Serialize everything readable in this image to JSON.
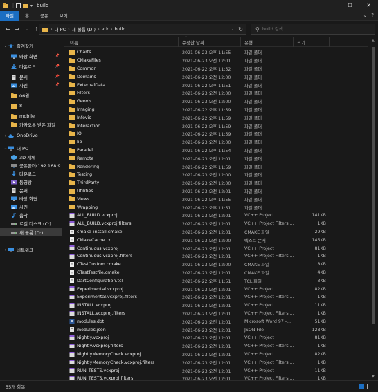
{
  "window": {
    "title": "build",
    "minimize_glyph": "—",
    "maximize_glyph": "☐",
    "close_glyph": "✕"
  },
  "ribbon": {
    "tabs": [
      "파일",
      "홈",
      "공유",
      "보기"
    ],
    "expand_glyph": "⌄",
    "help_glyph": "?"
  },
  "nav": {
    "back": "←",
    "forward": "→",
    "dropdown": "⌄",
    "up": "↑",
    "breadcrumbs": [
      "내 PC",
      "새 볼륨 (D:)",
      "vtk",
      "build"
    ],
    "refresh": "↻",
    "search_placeholder": "build 검색"
  },
  "sidebar": {
    "items": [
      {
        "label": "즐겨찾기",
        "icon": "star-icon",
        "level": 0,
        "chevron": "⌄"
      },
      {
        "label": "바탕 화면",
        "icon": "desktop-icon",
        "level": 1,
        "pinned": true
      },
      {
        "label": "다운로드",
        "icon": "download-icon",
        "level": 1,
        "pinned": true
      },
      {
        "label": "문서",
        "icon": "document-icon",
        "level": 1,
        "pinned": true
      },
      {
        "label": "사진",
        "icon": "pictures-icon",
        "level": 1,
        "pinned": true
      },
      {
        "label": "06월",
        "icon": "folder-icon",
        "level": 1
      },
      {
        "label": "8",
        "icon": "folder-icon",
        "level": 1
      },
      {
        "label": "mobile",
        "icon": "folder-icon",
        "level": 1
      },
      {
        "label": "카카오톡 받은 파일",
        "icon": "folder-icon",
        "level": 1
      },
      {
        "label": "OneDrive",
        "icon": "cloud-icon",
        "level": 0,
        "chevron": "›"
      },
      {
        "label": "내 PC",
        "icon": "pc-icon",
        "level": 0,
        "chevron": "⌄"
      },
      {
        "label": "3D 개체",
        "icon": "3d-objects-icon",
        "level": 1
      },
      {
        "label": "공유폴더(192.168.9",
        "icon": "network-drive-icon",
        "level": 1
      },
      {
        "label": "다운로드",
        "icon": "download-icon",
        "level": 1
      },
      {
        "label": "동영상",
        "icon": "video-icon",
        "level": 1
      },
      {
        "label": "문서",
        "icon": "document-icon",
        "level": 1
      },
      {
        "label": "바탕 화면",
        "icon": "desktop-icon",
        "level": 1
      },
      {
        "label": "사진",
        "icon": "pictures-icon",
        "level": 1
      },
      {
        "label": "음악",
        "icon": "music-icon",
        "level": 1
      },
      {
        "label": "로컬 디스크 (C:)",
        "icon": "drive-icon",
        "level": 1
      },
      {
        "label": "새 볼륨 (D:)",
        "icon": "drive-icon",
        "level": 1,
        "selected": true
      },
      {
        "label": "네트워크",
        "icon": "network-icon",
        "level": 0,
        "chevron": "›"
      }
    ]
  },
  "columns": {
    "name": "이름",
    "date": "수정한 날짜",
    "type": "유형",
    "size": "크기",
    "sort_glyph": "^"
  },
  "files": [
    {
      "name": "Charts",
      "date": "2021-06-23 오후 11:55",
      "type": "파일 폴더",
      "size": "",
      "kind": "folder"
    },
    {
      "name": "CMakeFiles",
      "date": "2021-06-23 오전 12:01",
      "type": "파일 폴더",
      "size": "",
      "kind": "folder"
    },
    {
      "name": "Common",
      "date": "2021-06-22 오후 11:52",
      "type": "파일 폴더",
      "size": "",
      "kind": "folder"
    },
    {
      "name": "Domains",
      "date": "2021-06-23 오전 12:00",
      "type": "파일 폴더",
      "size": "",
      "kind": "folder"
    },
    {
      "name": "ExternalData",
      "date": "2021-06-22 오후 11:51",
      "type": "파일 폴더",
      "size": "",
      "kind": "folder"
    },
    {
      "name": "Filters",
      "date": "2021-06-23 오전 12:00",
      "type": "파일 폴더",
      "size": "",
      "kind": "folder"
    },
    {
      "name": "Geovis",
      "date": "2021-06-23 오전 12:00",
      "type": "파일 폴더",
      "size": "",
      "kind": "folder"
    },
    {
      "name": "Imaging",
      "date": "2021-06-22 오후 11:59",
      "type": "파일 폴더",
      "size": "",
      "kind": "folder"
    },
    {
      "name": "Infovis",
      "date": "2021-06-22 오후 11:59",
      "type": "파일 폴더",
      "size": "",
      "kind": "folder"
    },
    {
      "name": "Interaction",
      "date": "2021-06-22 오후 11:59",
      "type": "파일 폴더",
      "size": "",
      "kind": "folder"
    },
    {
      "name": "IO",
      "date": "2021-06-22 오후 11:59",
      "type": "파일 폴더",
      "size": "",
      "kind": "folder"
    },
    {
      "name": "lib",
      "date": "2021-06-23 오전 12:00",
      "type": "파일 폴더",
      "size": "",
      "kind": "folder"
    },
    {
      "name": "Parallel",
      "date": "2021-06-22 오후 11:54",
      "type": "파일 폴더",
      "size": "",
      "kind": "folder"
    },
    {
      "name": "Remote",
      "date": "2021-06-23 오전 12:01",
      "type": "파일 폴더",
      "size": "",
      "kind": "folder"
    },
    {
      "name": "Rendering",
      "date": "2021-06-22 오후 11:59",
      "type": "파일 폴더",
      "size": "",
      "kind": "folder"
    },
    {
      "name": "Testing",
      "date": "2021-06-23 오전 12:00",
      "type": "파일 폴더",
      "size": "",
      "kind": "folder"
    },
    {
      "name": "ThirdParty",
      "date": "2021-06-23 오전 12:00",
      "type": "파일 폴더",
      "size": "",
      "kind": "folder"
    },
    {
      "name": "Utilities",
      "date": "2021-06-23 오전 12:01",
      "type": "파일 폴더",
      "size": "",
      "kind": "folder"
    },
    {
      "name": "Views",
      "date": "2021-06-22 오후 11:55",
      "type": "파일 폴더",
      "size": "",
      "kind": "folder"
    },
    {
      "name": "Wrapping",
      "date": "2021-06-22 오후 11:51",
      "type": "파일 폴더",
      "size": "",
      "kind": "folder"
    },
    {
      "name": "ALL_BUILD.vcxproj",
      "date": "2021-06-23 오전 12:01",
      "type": "VC++ Project",
      "size": "141KB",
      "kind": "vcxproj"
    },
    {
      "name": "ALL_BUILD.vcxproj.filters",
      "date": "2021-06-23 오전 12:01",
      "type": "VC++ Project Filters ...",
      "size": "1KB",
      "kind": "vcxproj"
    },
    {
      "name": "cmake_install.cmake",
      "date": "2021-06-23 오전 12:01",
      "type": "CMAKE 파일",
      "size": "29KB",
      "kind": "file"
    },
    {
      "name": "CMakeCache.txt",
      "date": "2021-06-23 오전 12:00",
      "type": "텍스트 문서",
      "size": "145KB",
      "kind": "file"
    },
    {
      "name": "Continuous.vcxproj",
      "date": "2021-06-23 오전 12:01",
      "type": "VC++ Project",
      "size": "81KB",
      "kind": "vcxproj"
    },
    {
      "name": "Continuous.vcxproj.filters",
      "date": "2021-06-23 오전 12:01",
      "type": "VC++ Project Filters ...",
      "size": "1KB",
      "kind": "vcxproj"
    },
    {
      "name": "CTestCustom.cmake",
      "date": "2021-06-23 오전 12:00",
      "type": "CMAKE 파일",
      "size": "8KB",
      "kind": "file"
    },
    {
      "name": "CTestTestfile.cmake",
      "date": "2021-06-23 오전 12:01",
      "type": "CMAKE 파일",
      "size": "4KB",
      "kind": "file"
    },
    {
      "name": "DartConfiguration.tcl",
      "date": "2021-06-22 오후 11:51",
      "type": "TCL 파일",
      "size": "3KB",
      "kind": "file"
    },
    {
      "name": "Experimental.vcxproj",
      "date": "2021-06-23 오전 12:01",
      "type": "VC++ Project",
      "size": "82KB",
      "kind": "vcxproj"
    },
    {
      "name": "Experimental.vcxproj.filters",
      "date": "2021-06-23 오전 12:01",
      "type": "VC++ Project Filters ...",
      "size": "1KB",
      "kind": "vcxproj"
    },
    {
      "name": "INSTALL.vcxproj",
      "date": "2021-06-23 오전 12:01",
      "type": "VC++ Project",
      "size": "11KB",
      "kind": "vcxproj"
    },
    {
      "name": "INSTALL.vcxproj.filters",
      "date": "2021-06-23 오전 12:01",
      "type": "VC++ Project Filters ...",
      "size": "1KB",
      "kind": "vcxproj"
    },
    {
      "name": "modules.dot",
      "date": "2021-06-23 오전 12:01",
      "type": "Microsoft Word 97 -...",
      "size": "51KB",
      "kind": "word"
    },
    {
      "name": "modules.json",
      "date": "2021-06-23 오전 12:01",
      "type": "JSON File",
      "size": "128KB",
      "kind": "json"
    },
    {
      "name": "Nightly.vcxproj",
      "date": "2021-06-23 오전 12:01",
      "type": "VC++ Project",
      "size": "81KB",
      "kind": "vcxproj"
    },
    {
      "name": "Nightly.vcxproj.filters",
      "date": "2021-06-23 오전 12:01",
      "type": "VC++ Project Filters ...",
      "size": "1KB",
      "kind": "vcxproj"
    },
    {
      "name": "NightlyMemoryCheck.vcxproj",
      "date": "2021-06-23 오전 12:01",
      "type": "VC++ Project",
      "size": "82KB",
      "kind": "vcxproj"
    },
    {
      "name": "NightlyMemoryCheck.vcxproj.filters",
      "date": "2021-06-23 오전 12:01",
      "type": "VC++ Project Filters ...",
      "size": "1KB",
      "kind": "vcxproj"
    },
    {
      "name": "RUN_TESTS.vcxproj",
      "date": "2021-06-23 오전 12:01",
      "type": "VC++ Project",
      "size": "11KB",
      "kind": "vcxproj"
    },
    {
      "name": "RUN_TESTS.vcxproj.filters",
      "date": "2021-06-23 오전 12:01",
      "type": "VC++ Project Filters ...",
      "size": "1KB",
      "kind": "vcxproj"
    }
  ],
  "status": {
    "item_count": "55개 항목"
  },
  "colors": {
    "accent": "#1b6ec2",
    "folder": "#e8b54a",
    "background": "#191919"
  }
}
